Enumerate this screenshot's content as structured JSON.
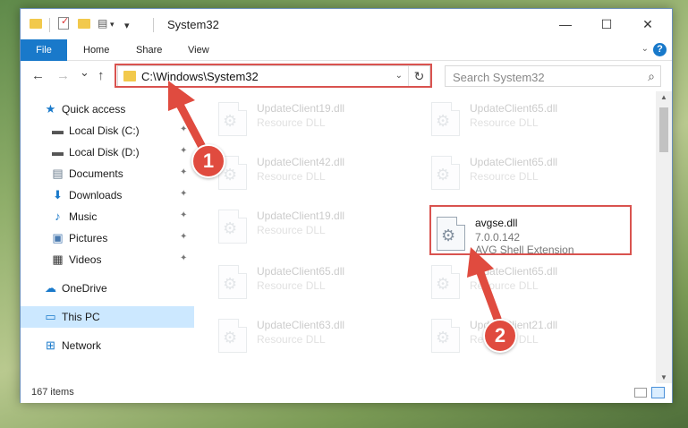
{
  "window": {
    "title": "System32",
    "minimize_glyph": "—",
    "maximize_glyph": "☐",
    "close_glyph": "✕"
  },
  "ribbon": {
    "tabs": [
      "File",
      "Home",
      "Share",
      "View"
    ],
    "help_glyph": "?"
  },
  "nav": {
    "back_glyph": "←",
    "forward_glyph": "→",
    "recent_glyph": "⌄",
    "up_glyph": "↑",
    "address": "C:\\Windows\\System32",
    "refresh_glyph": "↻",
    "search_placeholder": "Search System32",
    "search_glyph": "⌕"
  },
  "sidebar": {
    "items": [
      {
        "label": "Quick access",
        "icon": "star-icon",
        "glyph": "★",
        "color": "#1979ca",
        "pinned": false
      },
      {
        "label": "Local Disk (C:)",
        "icon": "drive-icon",
        "glyph": "▬",
        "color": "#555555",
        "pinned": true
      },
      {
        "label": "Local Disk (D:)",
        "icon": "drive-icon",
        "glyph": "▬",
        "color": "#555555",
        "pinned": true
      },
      {
        "label": "Documents",
        "icon": "documents-icon",
        "glyph": "▤",
        "color": "#6a7b8c",
        "pinned": true
      },
      {
        "label": "Downloads",
        "icon": "download-icon",
        "glyph": "⬇",
        "color": "#1979ca",
        "pinned": true
      },
      {
        "label": "Music",
        "icon": "music-icon",
        "glyph": "♪",
        "color": "#1979ca",
        "pinned": true
      },
      {
        "label": "Pictures",
        "icon": "pictures-icon",
        "glyph": "▣",
        "color": "#4a7ab0",
        "pinned": true
      },
      {
        "label": "Videos",
        "icon": "video-icon",
        "glyph": "▦",
        "color": "#333333",
        "pinned": true
      },
      {
        "label": "OneDrive",
        "icon": "cloud-icon",
        "glyph": "☁",
        "color": "#1979ca",
        "pinned": false
      },
      {
        "label": "This PC",
        "icon": "computer-icon",
        "glyph": "▭",
        "color": "#1979ca",
        "pinned": false
      },
      {
        "label": "Network",
        "icon": "network-icon",
        "glyph": "⊞",
        "color": "#1979ca",
        "pinned": false
      }
    ],
    "pin_glyph": "✦"
  },
  "files": [
    {
      "name": "UpdateClient19.dll",
      "line2": "Resource DLL",
      "line3": ""
    },
    {
      "name": "UpdateClient65.dll",
      "line2": "Resource DLL",
      "line3": ""
    },
    {
      "name": "UpdateClient42.dll",
      "line2": "Resource DLL",
      "line3": ""
    },
    {
      "name": "UpdateClient65.dll",
      "line2": "Resource DLL",
      "line3": ""
    },
    {
      "name": "UpdateClient19.dll",
      "line2": "Resource DLL",
      "line3": ""
    },
    {
      "name": "avgse.dll",
      "line2": "7.0.0.142",
      "line3": "AVG Shell Extension"
    },
    {
      "name": "UpdateClient65.dll",
      "line2": "Resource DLL",
      "line3": ""
    },
    {
      "name": "UpdateClient65.dll",
      "line2": "Resource DLL",
      "line3": ""
    },
    {
      "name": "UpdateClient63.dll",
      "line2": "Resource DLL",
      "line3": ""
    },
    {
      "name": "UpdateClient21.dll",
      "line2": "Resource DLL",
      "line3": ""
    }
  ],
  "status": {
    "item_count": "167 items"
  },
  "annotations": {
    "step1": "1",
    "step2": "2",
    "color": "#e04b3f"
  }
}
